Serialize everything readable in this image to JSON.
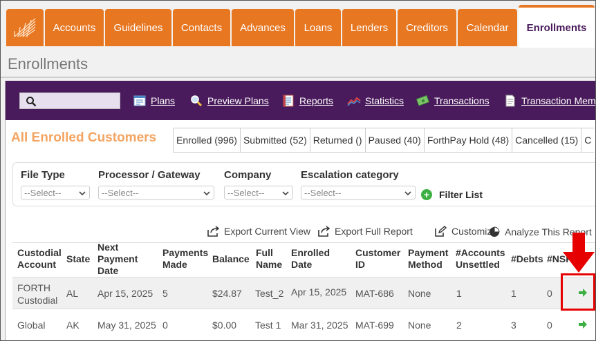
{
  "nav": {
    "tabs": [
      {
        "label": "Accounts"
      },
      {
        "label": "Guidelines"
      },
      {
        "label": "Contacts"
      },
      {
        "label": "Advances"
      },
      {
        "label": "Loans"
      },
      {
        "label": "Lenders"
      },
      {
        "label": "Creditors"
      },
      {
        "label": "Calendar"
      },
      {
        "label": "Enrollments",
        "active": true
      }
    ]
  },
  "page_title": "Enrollments",
  "toolbar": {
    "search_placeholder": "",
    "items": [
      {
        "label": "Plans",
        "icon": "plans-icon"
      },
      {
        "label": "Preview Plans",
        "icon": "magnifier-icon"
      },
      {
        "label": "Reports",
        "icon": "reports-icon"
      },
      {
        "label": "Statistics",
        "icon": "statistics-icon"
      },
      {
        "label": "Transactions",
        "icon": "money-icon"
      },
      {
        "label": "Transaction Memo",
        "icon": "memo-icon"
      }
    ]
  },
  "section_heading": "All Enrolled Customers",
  "status_tabs": [
    "Enrolled (996)",
    "Submitted (52)",
    "Returned ()",
    "Paused (40)",
    "ForthPay Hold (48)",
    "Cancelled (15)",
    "C"
  ],
  "filters": {
    "file_type": {
      "label": "File Type",
      "value": "--Select--"
    },
    "processor": {
      "label": "Processor / Gateway",
      "value": "--Select--"
    },
    "company": {
      "label": "Company",
      "value": "--Select--"
    },
    "escalation": {
      "label": "Escalation category",
      "value": "--Select--"
    },
    "filter_button": "Filter List"
  },
  "actions": {
    "export_current": "Export Current View",
    "export_full": "Export Full Report",
    "customize": "Customize",
    "analyze": "Analyze This Report"
  },
  "table": {
    "headers": {
      "custodial": [
        "Custodial",
        "Account"
      ],
      "state": [
        "State"
      ],
      "next_payment": [
        "Next",
        "Payment",
        "Date"
      ],
      "payments_made": [
        "Payments",
        "Made"
      ],
      "balance": [
        "Balance"
      ],
      "full_name": [
        "Full",
        "Name"
      ],
      "enrolled_date": [
        "Enrolled",
        "Date"
      ],
      "customer_id": [
        "Customer",
        "ID"
      ],
      "payment_method": [
        "Payment",
        "Method"
      ],
      "accounts_unsettled": [
        "#Accounts",
        "Unsettled"
      ],
      "debts": [
        "#Debts"
      ],
      "nsfs": [
        "#NSFs"
      ]
    },
    "rows": [
      {
        "custodial": [
          "FORTH",
          "Custodial"
        ],
        "state": "AL",
        "next_payment": "Apr 15, 2025",
        "payments_made": "5",
        "balance": "$24.87",
        "full_name": "Test_2",
        "enrolled_date": "Apr 15, 2025",
        "customer_id": "MAT-686",
        "payment_method": "None",
        "accounts_unsettled": "1",
        "debts": "1",
        "nsfs": "0"
      },
      {
        "custodial": [
          "Global",
          ""
        ],
        "state": "AK",
        "next_payment": "May 31, 2025",
        "payments_made": "0",
        "balance": "$0.00",
        "full_name": "Test 1",
        "enrolled_date": "Mar 31, 2025",
        "customer_id": "MAT-699",
        "payment_method": "None",
        "accounts_unsettled": "2",
        "debts": "3",
        "nsfs": "0"
      }
    ]
  },
  "colors": {
    "brand_orange": "#e87722",
    "brand_purple": "#4a1b5c",
    "heading_orange": "#f4a460",
    "go_green": "#3cb043",
    "annotation_red": "#e60000"
  }
}
